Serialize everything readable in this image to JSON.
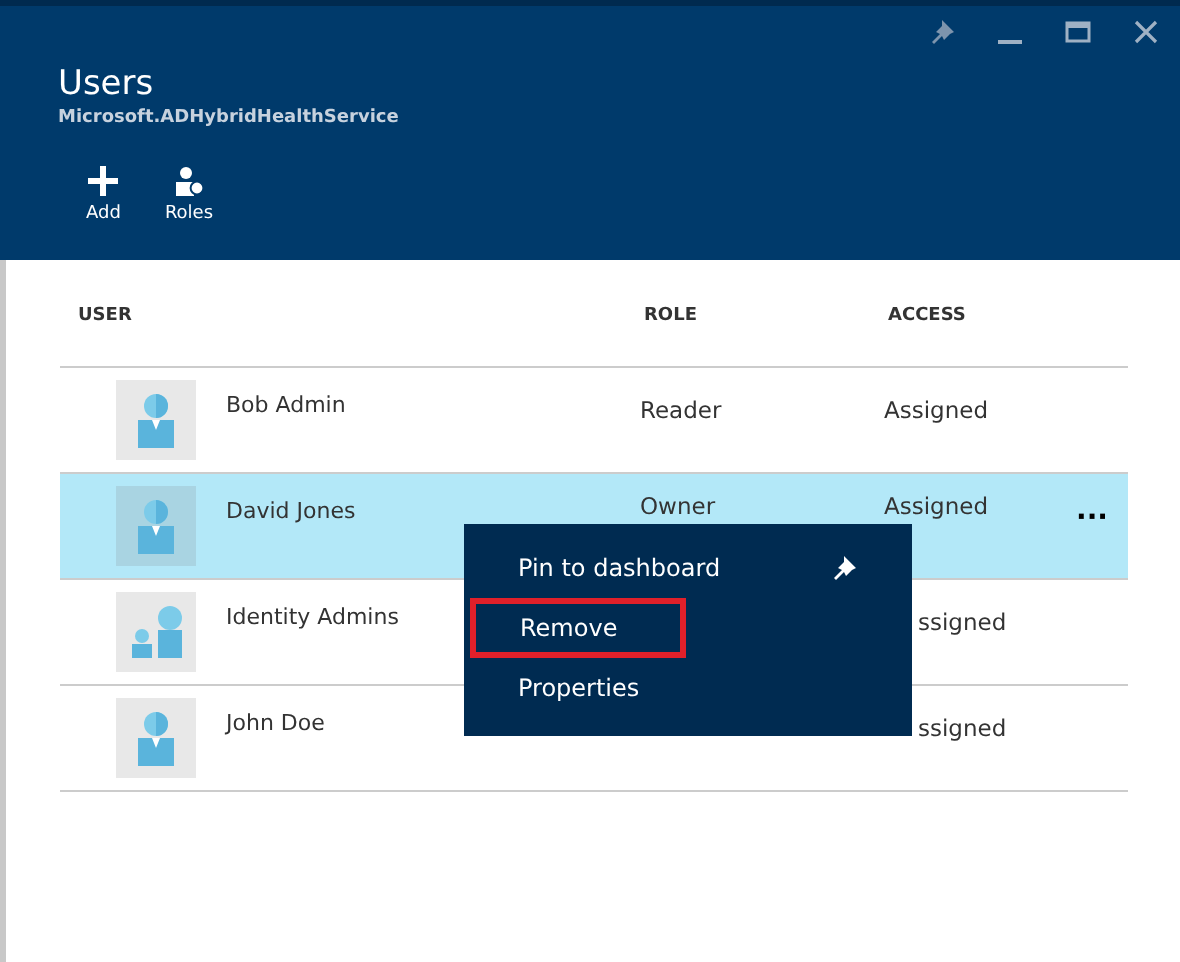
{
  "blade": {
    "title": "Users",
    "subtitle": "Microsoft.ADHybridHealthService"
  },
  "commands": [
    {
      "kind": "add",
      "label": "Add"
    },
    {
      "kind": "roles",
      "label": "Roles"
    }
  ],
  "table": {
    "columns": [
      "USER",
      "ROLE",
      "ACCESS"
    ],
    "rows": [
      {
        "kind": "user",
        "name": "Bob Admin",
        "role": "Reader",
        "access": "Assigned",
        "selected": false
      },
      {
        "kind": "user",
        "name": "David Jones",
        "role": "Owner",
        "access": "Assigned",
        "selected": true,
        "more": "···"
      },
      {
        "kind": "group",
        "name": "Identity Admins",
        "access": "ssigned",
        "selected": false
      },
      {
        "kind": "user",
        "name": "John Doe",
        "access": "ssigned",
        "selected": false
      }
    ]
  },
  "context_menu": {
    "items": [
      {
        "kind": "pin",
        "label": "Pin to dashboard",
        "highlighted": false
      },
      {
        "kind": "plain",
        "label": "Remove",
        "highlighted": true
      },
      {
        "kind": "plain",
        "label": "Properties",
        "highlighted": false
      }
    ]
  }
}
